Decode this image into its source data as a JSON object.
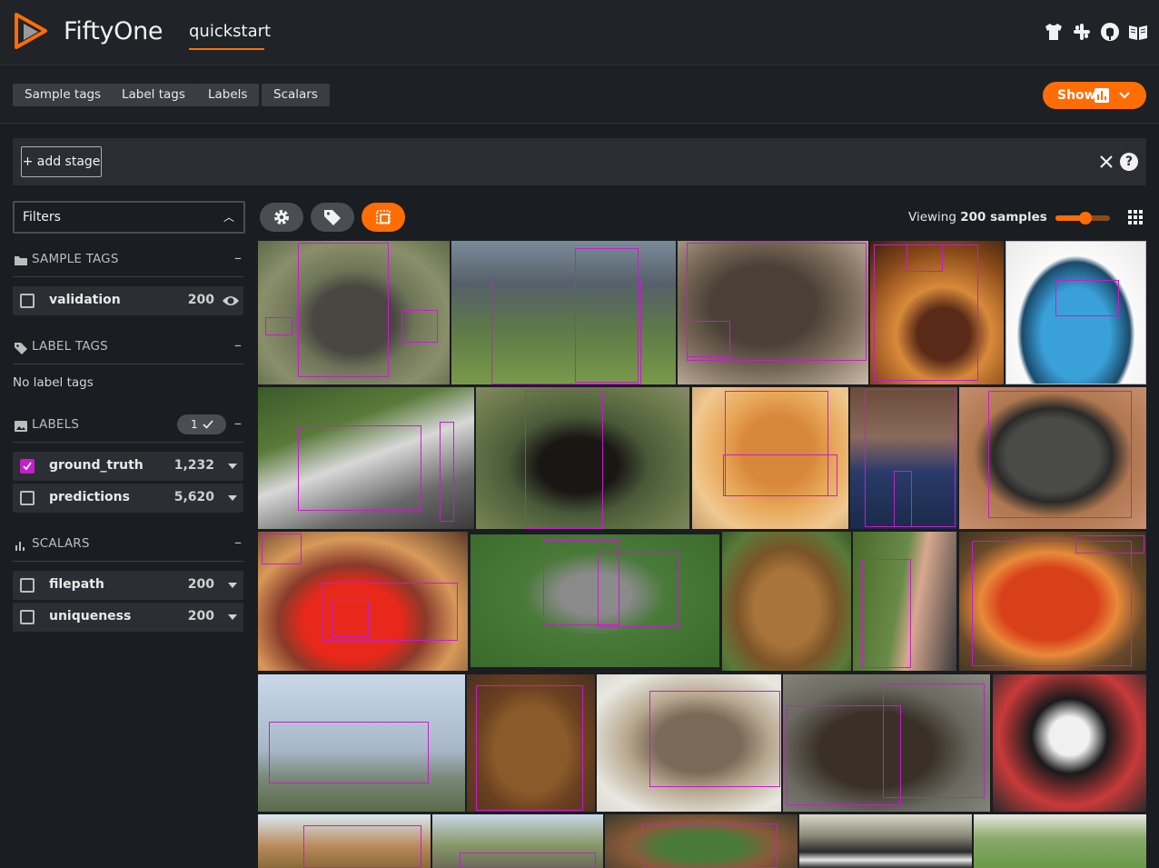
{
  "header": {
    "brand": "FiftyOne",
    "dataset": "quickstart",
    "icons": [
      "tshirt-icon",
      "slack-icon",
      "github-icon",
      "book-icon"
    ]
  },
  "tagbar": {
    "buttons": [
      "Sample tags",
      "Label tags",
      "Labels",
      "Scalars"
    ],
    "show_label": "Show"
  },
  "viewbar": {
    "add_stage": "+ add stage"
  },
  "sidebar": {
    "filters_label": "Filters",
    "sample_tags": {
      "title": "SAMPLE TAGS",
      "rows": [
        {
          "label": "validation",
          "count": "200"
        }
      ]
    },
    "label_tags": {
      "title": "LABEL TAGS",
      "empty": "No label tags"
    },
    "labels": {
      "title": "LABELS",
      "badge": "1",
      "rows": [
        {
          "label": "ground_truth",
          "count": "1,232",
          "checked": true
        },
        {
          "label": "predictions",
          "count": "5,620",
          "checked": false
        }
      ]
    },
    "scalars": {
      "title": "SCALARS",
      "rows": [
        {
          "label": "filepath",
          "count": "200"
        },
        {
          "label": "uniqueness",
          "count": "200"
        }
      ]
    }
  },
  "grid": {
    "viewing_prefix": "Viewing",
    "viewing_count": "200 samples",
    "zoom_level": 0.55
  },
  "colors": {
    "accent": "#ff6d04",
    "box": "#c51ec9",
    "background": "#1a1d21"
  }
}
